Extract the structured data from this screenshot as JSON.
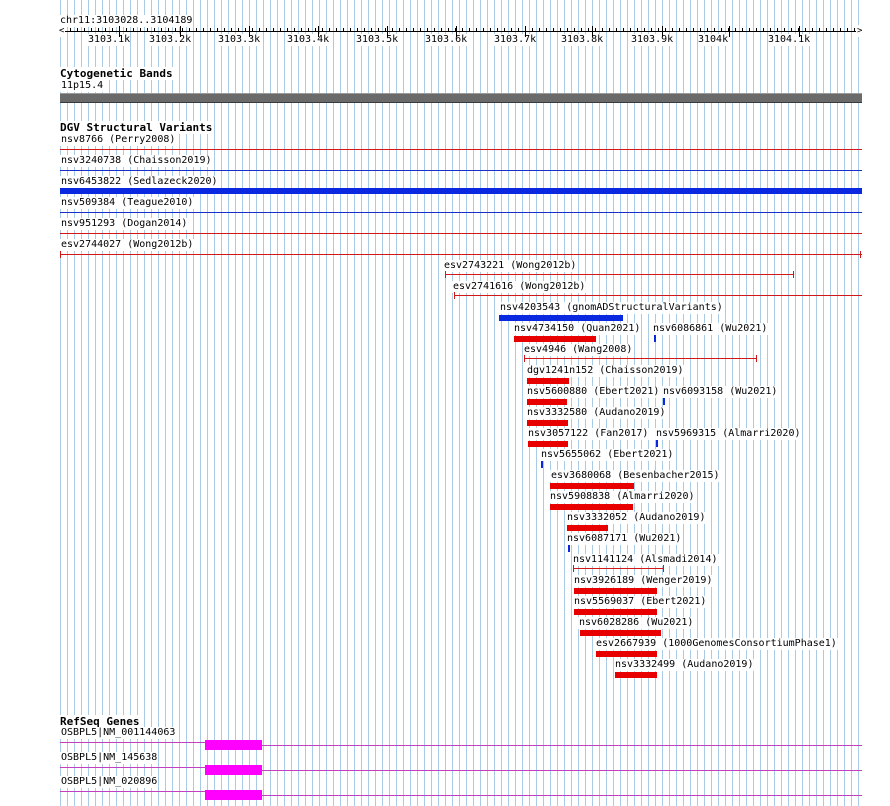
{
  "ruler": {
    "position": "chr11:3103028..3104189",
    "ticks": [
      "3103.1k",
      "3103.2k",
      "3103.3k",
      "3103.4k",
      "3103.5k",
      "3103.6k",
      "3103.7k",
      "3103.8k",
      "3103.9k",
      "3104k",
      "3104.1k"
    ]
  },
  "cytoband": {
    "title": "Cytogenetic Bands",
    "band": "11p15.4"
  },
  "dgv": {
    "title": "DGV Structural Variants",
    "full_width": [
      {
        "label": "nsv8766 (Perry2008)",
        "color": "#d01818",
        "kind": "line"
      },
      {
        "label": "nsv3240738 (Chaisson2019)",
        "color": "#1830c8",
        "kind": "line"
      },
      {
        "label": "nsv6453822 (Sedlazeck2020)",
        "color": "#0a28e0",
        "kind": "bar"
      },
      {
        "label": "nsv509384 (Teague2010)",
        "color": "#1830c8",
        "kind": "line"
      },
      {
        "label": "nsv951293 (Dogan2014)",
        "color": "#d01818",
        "kind": "line"
      },
      {
        "label": "esv2744027 (Wong2012b)",
        "color": "#d01818",
        "kind": "capline"
      }
    ],
    "features": [
      {
        "label": "esv2743221 (Wong2012b)",
        "color": "#d01818",
        "kind": "capline"
      },
      {
        "label": "esv2741616 (Wong2012b)",
        "color": "#d01818",
        "kind": "capline"
      },
      {
        "label": "nsv4203543 (gnomADStructuralVariants)",
        "color": "#0a28e0",
        "kind": "bar"
      },
      {
        "label": "nsv4734150 (Quan2021)",
        "color": "#e80000",
        "kind": "bar"
      },
      {
        "label": "nsv6086861 (Wu2021)",
        "color": "#0a28e0",
        "kind": "mark"
      },
      {
        "label": "esv4946 (Wang2008)",
        "color": "#d01818",
        "kind": "capline"
      },
      {
        "label": "dgv1241n152 (Chaisson2019)",
        "color": "#e80000",
        "kind": "bar"
      },
      {
        "label": "nsv5600880 (Ebert2021)",
        "color": "#e80000",
        "kind": "bar"
      },
      {
        "label": "nsv6093158 (Wu2021)",
        "color": "#0a28e0",
        "kind": "mark"
      },
      {
        "label": "nsv3332580 (Audano2019)",
        "color": "#e80000",
        "kind": "bar"
      },
      {
        "label": "nsv3057122 (Fan2017)",
        "color": "#e80000",
        "kind": "bar"
      },
      {
        "label": "nsv5969315 (Almarri2020)",
        "color": "#0a28e0",
        "kind": "mark"
      },
      {
        "label": "nsv5655062 (Ebert2021)",
        "color": "#0a28e0",
        "kind": "mark"
      },
      {
        "label": "esv3680068 (Besenbacher2015)",
        "color": "#e80000",
        "kind": "bar"
      },
      {
        "label": "nsv5908838 (Almarri2020)",
        "color": "#e80000",
        "kind": "bar"
      },
      {
        "label": "nsv3332052 (Audano2019)",
        "color": "#e80000",
        "kind": "bar"
      },
      {
        "label": "nsv6087171 (Wu2021)",
        "color": "#0a28e0",
        "kind": "mark"
      },
      {
        "label": "nsv1141124 (Alsmadi2014)",
        "color": "#d01818",
        "kind": "capline"
      },
      {
        "label": "nsv3926189 (Wenger2019)",
        "color": "#e80000",
        "kind": "bar"
      },
      {
        "label": "nsv5569037 (Ebert2021)",
        "color": "#e80000",
        "kind": "bar"
      },
      {
        "label": "nsv6028286 (Wu2021)",
        "color": "#e80000",
        "kind": "bar"
      },
      {
        "label": "esv2667939 (1000GenomesConsortiumPhase1)",
        "color": "#e80000",
        "kind": "bar"
      },
      {
        "label": "nsv3332499 (Audano2019)",
        "color": "#e80000",
        "kind": "bar"
      }
    ]
  },
  "refseq": {
    "title": "RefSeq Genes",
    "line_color": "#c040c0",
    "exon_color": "#ff00ff",
    "transcripts": [
      {
        "label": "OSBPL5|NM_001144063"
      },
      {
        "label": "OSBPL5|NM_145638"
      },
      {
        "label": "OSBPL5|NM_020896"
      }
    ]
  }
}
